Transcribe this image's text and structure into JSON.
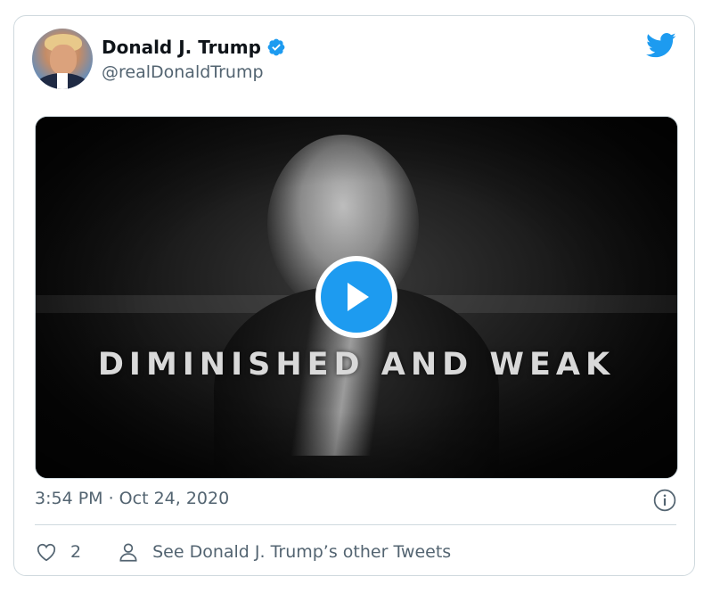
{
  "tweet": {
    "author_name": "Donald J. Trump",
    "handle": "@realDonaldTrump",
    "video_caption": "DIMINISHED AND WEAK",
    "timestamp": "3:54 PM · Oct 24, 2020",
    "like_count": "2",
    "other_tweets_label": "See Donald J. Trump’s other Tweets"
  },
  "icons": {
    "verified": "verified-badge-icon",
    "brand": "twitter-bird-icon",
    "play": "play-icon",
    "info": "info-icon",
    "like": "heart-icon",
    "profile": "person-icon"
  },
  "colors": {
    "accent": "#1d9bf0",
    "text_primary": "#0f1419",
    "text_secondary": "#536471",
    "border": "#cfd9de"
  }
}
